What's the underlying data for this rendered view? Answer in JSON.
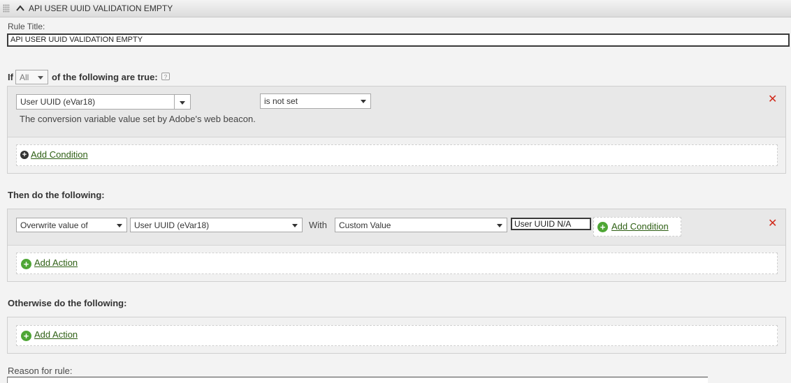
{
  "header": {
    "title": "API USER UUID VALIDATION EMPTY"
  },
  "rule_title": {
    "label": "Rule Title:",
    "value": "API USER UUID VALIDATION EMPTY"
  },
  "if_row": {
    "if_text": "If",
    "match_value": "All",
    "following_text": "of the following are true:"
  },
  "condition": {
    "variable": "User UUID (eVar18)",
    "operator": "is not set",
    "description": "The conversion variable value set by Adobe's web beacon."
  },
  "add_condition_label": "Add Condition",
  "then_section": {
    "label": "Then do the following:"
  },
  "action": {
    "type": "Overwrite value of",
    "variable": "User UUID (eVar18)",
    "with_text": "With",
    "value_type": "Custom Value",
    "custom_value": "User UUID N/A"
  },
  "add_action_label": "Add Action",
  "otherwise_section": {
    "label": "Otherwise do the following:"
  },
  "reason": {
    "label": "Reason for rule:"
  },
  "colors": {
    "link": "#2e5f14",
    "plus_green": "#4ea635",
    "remove_red": "#d12a1b"
  }
}
